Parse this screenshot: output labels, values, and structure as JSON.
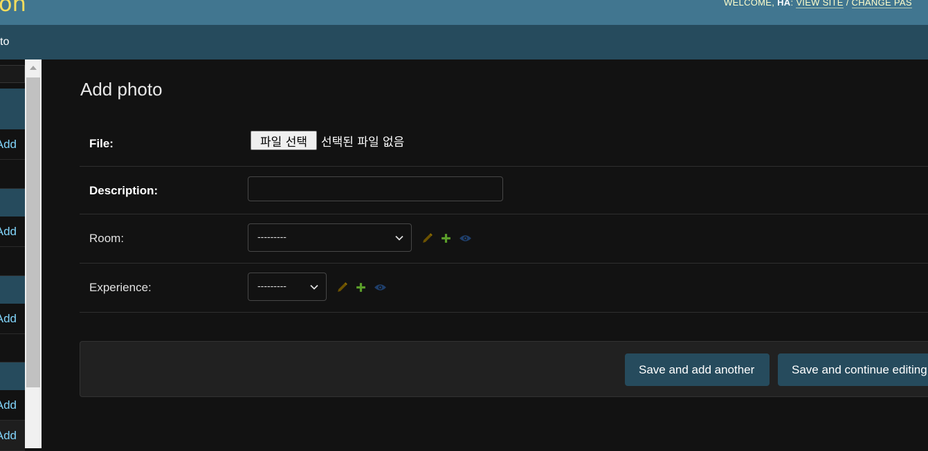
{
  "header": {
    "branding_text": "on",
    "welcome": "WELCOME,",
    "username": "HA",
    "view_site": "VIEW SITE",
    "separator": "/",
    "change_password": "CHANGE PAS"
  },
  "breadcrumbs": {
    "text": "to"
  },
  "sidebar": {
    "add_links": [
      "Add",
      "Add",
      "Add",
      "Add",
      "Add"
    ]
  },
  "page": {
    "title": "Add photo"
  },
  "form": {
    "file": {
      "label": "File:",
      "button": "파일 선택",
      "status": "선택된 파일 없음"
    },
    "description": {
      "label": "Description:",
      "value": ""
    },
    "room": {
      "label": "Room:",
      "selected": "---------"
    },
    "experience": {
      "label": "Experience:",
      "selected": "---------"
    }
  },
  "submit": {
    "save_add_another": "Save and add another",
    "save_continue": "Save and continue editing"
  },
  "colors": {
    "header_bg": "#417690",
    "breadcrumbs_bg": "#264b5d",
    "branding": "#f5dd5d",
    "link": "#81d4fa",
    "button_bg": "#264b5d",
    "page_bg": "#121212",
    "change_icon": "#6b5100",
    "add_icon": "#5b9e2a",
    "view_icon": "#1f3f6b"
  },
  "icons": {
    "change": "pencil-icon",
    "add": "plus-icon",
    "view": "eye-icon"
  }
}
